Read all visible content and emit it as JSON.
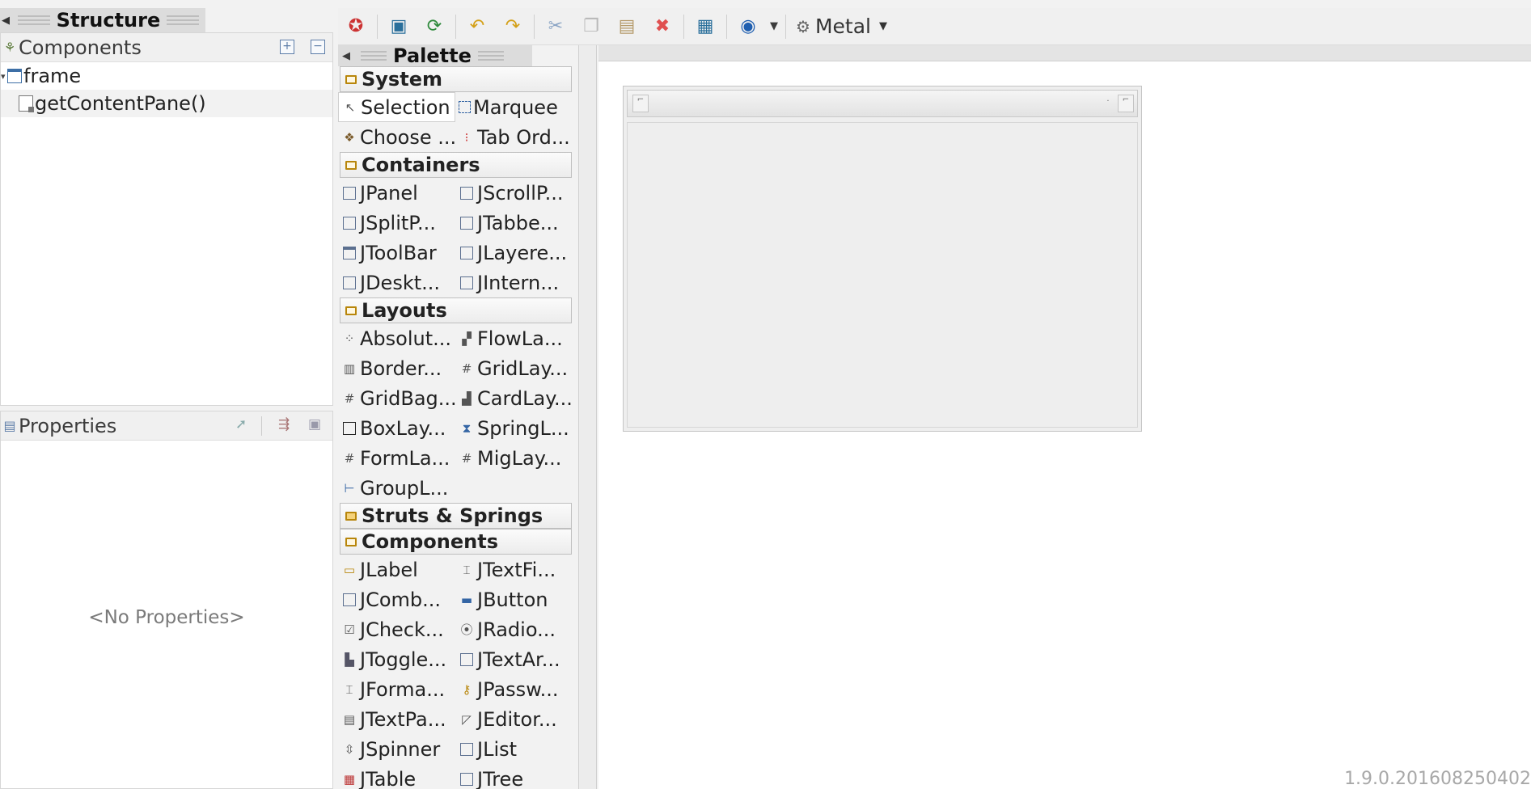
{
  "structure": {
    "title": "Structure",
    "components": {
      "title": "Components",
      "tree": [
        {
          "label": "frame"
        },
        {
          "label": "getContentPane()"
        }
      ]
    },
    "properties": {
      "title": "Properties",
      "empty_text": "<No Properties>"
    }
  },
  "toolbar": {
    "icons": [
      "test-gui-icon",
      "preview-icon",
      "refresh-icon",
      "undo-icon",
      "redo-icon",
      "cut-icon",
      "copy-icon",
      "paste-icon",
      "delete-icon",
      "nls-icon",
      "globe-icon"
    ],
    "look_and_feel": "Metal"
  },
  "palette": {
    "title": "Palette",
    "categories": [
      {
        "name": "System",
        "items": [
          "Selection",
          "Marquee",
          "Choose ...",
          "Tab Ord..."
        ]
      },
      {
        "name": "Containers",
        "items": [
          "JPanel",
          "JScrollP...",
          "JSplitP...",
          "JTabbe...",
          "JToolBar",
          "JLayere...",
          "JDeskt...",
          "JIntern..."
        ]
      },
      {
        "name": "Layouts",
        "items": [
          "Absolut...",
          "FlowLa...",
          "Border...",
          "GridLay...",
          "GridBag...",
          "CardLay...",
          "BoxLay...",
          "SpringL...",
          "FormLa...",
          "MigLay...",
          "GroupL..."
        ]
      },
      {
        "name": "Struts & Springs",
        "items": []
      },
      {
        "name": "Components",
        "items": [
          "JLabel",
          "JTextFi...",
          "JComb...",
          "JButton",
          "JCheck...",
          "JRadio...",
          "JToggle...",
          "JTextAr...",
          "JForma...",
          "JPassw...",
          "JTextPa...",
          "JEditor...",
          "JSpinner",
          "JList",
          "JTable",
          "JTree"
        ]
      }
    ]
  },
  "version": "1.9.0.201608250402"
}
